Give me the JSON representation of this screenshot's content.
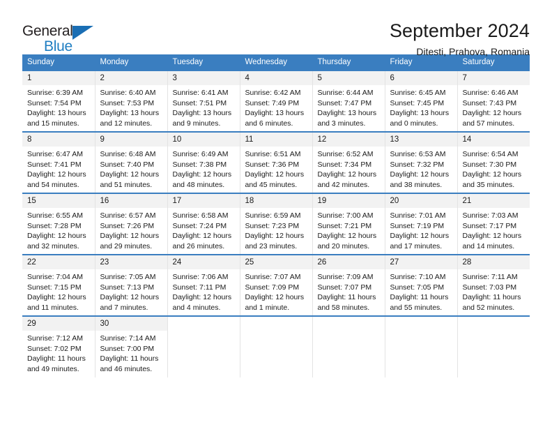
{
  "brand": {
    "name_part1": "General",
    "name_part2": "Blue",
    "accent_color": "#1f7ec2",
    "triangle_icon": "triangle-icon"
  },
  "header": {
    "title": "September 2024",
    "subtitle": "Ditesti, Prahova, Romania"
  },
  "calendar": {
    "header_bg": "#3a7ec0",
    "daynum_bg": "#f2f2f2",
    "weekdays": [
      "Sunday",
      "Monday",
      "Tuesday",
      "Wednesday",
      "Thursday",
      "Friday",
      "Saturday"
    ],
    "weeks": [
      [
        {
          "day": "1",
          "sunrise": "Sunrise: 6:39 AM",
          "sunset": "Sunset: 7:54 PM",
          "daylight1": "Daylight: 13 hours",
          "daylight2": "and 15 minutes."
        },
        {
          "day": "2",
          "sunrise": "Sunrise: 6:40 AM",
          "sunset": "Sunset: 7:53 PM",
          "daylight1": "Daylight: 13 hours",
          "daylight2": "and 12 minutes."
        },
        {
          "day": "3",
          "sunrise": "Sunrise: 6:41 AM",
          "sunset": "Sunset: 7:51 PM",
          "daylight1": "Daylight: 13 hours",
          "daylight2": "and 9 minutes."
        },
        {
          "day": "4",
          "sunrise": "Sunrise: 6:42 AM",
          "sunset": "Sunset: 7:49 PM",
          "daylight1": "Daylight: 13 hours",
          "daylight2": "and 6 minutes."
        },
        {
          "day": "5",
          "sunrise": "Sunrise: 6:44 AM",
          "sunset": "Sunset: 7:47 PM",
          "daylight1": "Daylight: 13 hours",
          "daylight2": "and 3 minutes."
        },
        {
          "day": "6",
          "sunrise": "Sunrise: 6:45 AM",
          "sunset": "Sunset: 7:45 PM",
          "daylight1": "Daylight: 13 hours",
          "daylight2": "and 0 minutes."
        },
        {
          "day": "7",
          "sunrise": "Sunrise: 6:46 AM",
          "sunset": "Sunset: 7:43 PM",
          "daylight1": "Daylight: 12 hours",
          "daylight2": "and 57 minutes."
        }
      ],
      [
        {
          "day": "8",
          "sunrise": "Sunrise: 6:47 AM",
          "sunset": "Sunset: 7:41 PM",
          "daylight1": "Daylight: 12 hours",
          "daylight2": "and 54 minutes."
        },
        {
          "day": "9",
          "sunrise": "Sunrise: 6:48 AM",
          "sunset": "Sunset: 7:40 PM",
          "daylight1": "Daylight: 12 hours",
          "daylight2": "and 51 minutes."
        },
        {
          "day": "10",
          "sunrise": "Sunrise: 6:49 AM",
          "sunset": "Sunset: 7:38 PM",
          "daylight1": "Daylight: 12 hours",
          "daylight2": "and 48 minutes."
        },
        {
          "day": "11",
          "sunrise": "Sunrise: 6:51 AM",
          "sunset": "Sunset: 7:36 PM",
          "daylight1": "Daylight: 12 hours",
          "daylight2": "and 45 minutes."
        },
        {
          "day": "12",
          "sunrise": "Sunrise: 6:52 AM",
          "sunset": "Sunset: 7:34 PM",
          "daylight1": "Daylight: 12 hours",
          "daylight2": "and 42 minutes."
        },
        {
          "day": "13",
          "sunrise": "Sunrise: 6:53 AM",
          "sunset": "Sunset: 7:32 PM",
          "daylight1": "Daylight: 12 hours",
          "daylight2": "and 38 minutes."
        },
        {
          "day": "14",
          "sunrise": "Sunrise: 6:54 AM",
          "sunset": "Sunset: 7:30 PM",
          "daylight1": "Daylight: 12 hours",
          "daylight2": "and 35 minutes."
        }
      ],
      [
        {
          "day": "15",
          "sunrise": "Sunrise: 6:55 AM",
          "sunset": "Sunset: 7:28 PM",
          "daylight1": "Daylight: 12 hours",
          "daylight2": "and 32 minutes."
        },
        {
          "day": "16",
          "sunrise": "Sunrise: 6:57 AM",
          "sunset": "Sunset: 7:26 PM",
          "daylight1": "Daylight: 12 hours",
          "daylight2": "and 29 minutes."
        },
        {
          "day": "17",
          "sunrise": "Sunrise: 6:58 AM",
          "sunset": "Sunset: 7:24 PM",
          "daylight1": "Daylight: 12 hours",
          "daylight2": "and 26 minutes."
        },
        {
          "day": "18",
          "sunrise": "Sunrise: 6:59 AM",
          "sunset": "Sunset: 7:23 PM",
          "daylight1": "Daylight: 12 hours",
          "daylight2": "and 23 minutes."
        },
        {
          "day": "19",
          "sunrise": "Sunrise: 7:00 AM",
          "sunset": "Sunset: 7:21 PM",
          "daylight1": "Daylight: 12 hours",
          "daylight2": "and 20 minutes."
        },
        {
          "day": "20",
          "sunrise": "Sunrise: 7:01 AM",
          "sunset": "Sunset: 7:19 PM",
          "daylight1": "Daylight: 12 hours",
          "daylight2": "and 17 minutes."
        },
        {
          "day": "21",
          "sunrise": "Sunrise: 7:03 AM",
          "sunset": "Sunset: 7:17 PM",
          "daylight1": "Daylight: 12 hours",
          "daylight2": "and 14 minutes."
        }
      ],
      [
        {
          "day": "22",
          "sunrise": "Sunrise: 7:04 AM",
          "sunset": "Sunset: 7:15 PM",
          "daylight1": "Daylight: 12 hours",
          "daylight2": "and 11 minutes."
        },
        {
          "day": "23",
          "sunrise": "Sunrise: 7:05 AM",
          "sunset": "Sunset: 7:13 PM",
          "daylight1": "Daylight: 12 hours",
          "daylight2": "and 7 minutes."
        },
        {
          "day": "24",
          "sunrise": "Sunrise: 7:06 AM",
          "sunset": "Sunset: 7:11 PM",
          "daylight1": "Daylight: 12 hours",
          "daylight2": "and 4 minutes."
        },
        {
          "day": "25",
          "sunrise": "Sunrise: 7:07 AM",
          "sunset": "Sunset: 7:09 PM",
          "daylight1": "Daylight: 12 hours",
          "daylight2": "and 1 minute."
        },
        {
          "day": "26",
          "sunrise": "Sunrise: 7:09 AM",
          "sunset": "Sunset: 7:07 PM",
          "daylight1": "Daylight: 11 hours",
          "daylight2": "and 58 minutes."
        },
        {
          "day": "27",
          "sunrise": "Sunrise: 7:10 AM",
          "sunset": "Sunset: 7:05 PM",
          "daylight1": "Daylight: 11 hours",
          "daylight2": "and 55 minutes."
        },
        {
          "day": "28",
          "sunrise": "Sunrise: 7:11 AM",
          "sunset": "Sunset: 7:03 PM",
          "daylight1": "Daylight: 11 hours",
          "daylight2": "and 52 minutes."
        }
      ],
      [
        {
          "day": "29",
          "sunrise": "Sunrise: 7:12 AM",
          "sunset": "Sunset: 7:02 PM",
          "daylight1": "Daylight: 11 hours",
          "daylight2": "and 49 minutes."
        },
        {
          "day": "30",
          "sunrise": "Sunrise: 7:14 AM",
          "sunset": "Sunset: 7:00 PM",
          "daylight1": "Daylight: 11 hours",
          "daylight2": "and 46 minutes."
        },
        {
          "day": "",
          "sunrise": "",
          "sunset": "",
          "daylight1": "",
          "daylight2": ""
        },
        {
          "day": "",
          "sunrise": "",
          "sunset": "",
          "daylight1": "",
          "daylight2": ""
        },
        {
          "day": "",
          "sunrise": "",
          "sunset": "",
          "daylight1": "",
          "daylight2": ""
        },
        {
          "day": "",
          "sunrise": "",
          "sunset": "",
          "daylight1": "",
          "daylight2": ""
        },
        {
          "day": "",
          "sunrise": "",
          "sunset": "",
          "daylight1": "",
          "daylight2": ""
        }
      ]
    ]
  }
}
